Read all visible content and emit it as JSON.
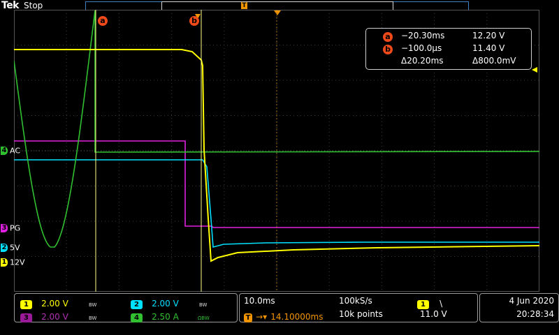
{
  "header": {
    "brand": "Tek",
    "run_state": "Stop",
    "trigger_position_label": "T"
  },
  "channels": [
    {
      "num": "1",
      "label": "12V",
      "color": "#ffff00",
      "scale": "2.00 V",
      "bandwidth": "BW"
    },
    {
      "num": "2",
      "label": "5V",
      "color": "#00e0ff",
      "scale": "2.00 V",
      "bandwidth": "BW"
    },
    {
      "num": "3",
      "label": "PG",
      "color": "#e020e0",
      "scale": "2.00 V",
      "bandwidth": "BW"
    },
    {
      "num": "4",
      "label": "AC",
      "color": "#30c030",
      "scale": "2.50 A",
      "bandwidth": "ΩBW"
    }
  ],
  "cursors": {
    "a_label": "a",
    "b_label": "b",
    "a_time": "−20.30ms",
    "a_value": "12.20 V",
    "b_time": "−100.0µs",
    "b_value": "11.40 V",
    "delta_time": "Δ20.20ms",
    "delta_value": "Δ800.0mV",
    "color": "#f04a1a"
  },
  "timebase": {
    "scale": "10.0ms",
    "sample_rate": "100kS/s",
    "trigger_delay": "14.10000ms",
    "record_length": "10k points"
  },
  "trigger": {
    "source": "1",
    "slope_icon": "falling-edge-icon",
    "slope_glyph": "\\",
    "level": "11.0 V"
  },
  "datetime": {
    "date": "4 Jun  2020",
    "time": "20:28:34"
  }
}
